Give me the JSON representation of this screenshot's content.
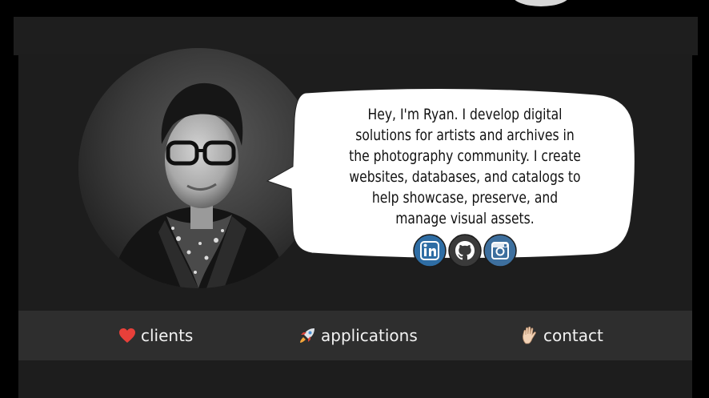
{
  "intro": {
    "text": "Hey, I'm Ryan. I develop digital solutions for artists and archives in the photography community. I create websites, databases, and catalogs to help showcase, preserve, and manage visual assets."
  },
  "social": [
    {
      "icon": "linkedin-icon",
      "color": "#2e6da4"
    },
    {
      "icon": "github-icon",
      "color": "#3a3a3a"
    },
    {
      "icon": "instagram-icon",
      "color": "#3d6f9e"
    }
  ],
  "nav": {
    "items": [
      {
        "label": "clients",
        "icon": "heart-icon"
      },
      {
        "label": "applications",
        "icon": "rocket-icon"
      },
      {
        "label": "contact",
        "icon": "waving-hand-icon"
      }
    ]
  },
  "colors": {
    "background": "#000000",
    "panel": "#1d1d1d",
    "nav_bar": "#2e2e2e",
    "nav_text": "#f2f2f2",
    "bubble": "#ffffff"
  }
}
